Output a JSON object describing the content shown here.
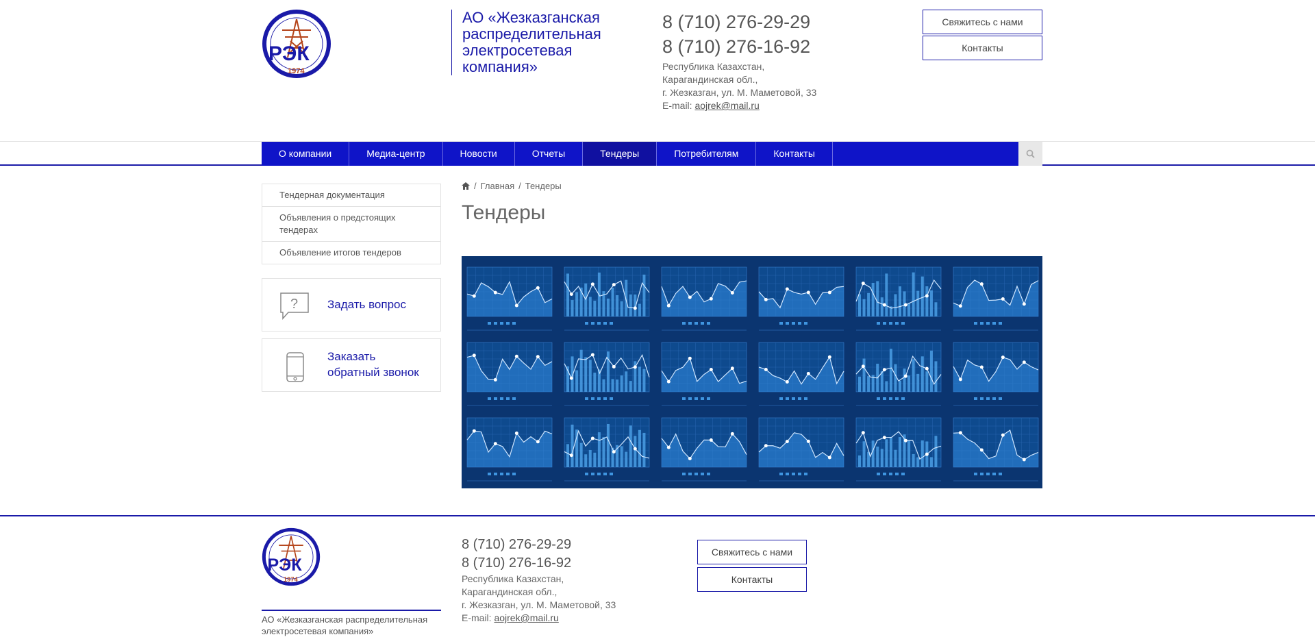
{
  "logo": {
    "year": "1974",
    "abbr": "РЭК",
    "arc_text": "АО Жезказганская"
  },
  "header": {
    "company_name": "АО «Жезказганская распределительная электросетевая компания»",
    "phone1": "8 (710) 276-29-29",
    "phone2": "8 (710) 276-16-92",
    "address": [
      "Республика Казахстан,",
      "Карагандинская обл.,",
      "г. Жезказган, ул. М. Маметовой, 33"
    ],
    "email_label": "E-mail:",
    "email": "aojrek@mail.ru",
    "btn_contact": "Свяжитесь с нами",
    "btn_contacts": "Контакты"
  },
  "nav": {
    "items": [
      "О компании",
      "Медиа-центр",
      "Новости",
      "Отчеты",
      "Тендеры",
      "Потребителям",
      "Контакты"
    ],
    "active": "Тендеры"
  },
  "sidebar": {
    "items": [
      "Тендерная документация",
      "Объявления о предстоящих тендерах",
      "Объявление итогов тендеров"
    ],
    "ask": "Задать вопрос",
    "callback_line1": "Заказать",
    "callback_line2": "обратный звонок"
  },
  "breadcrumb": {
    "home": "Главная",
    "current": "Тендеры"
  },
  "page": {
    "title": "Тендеры"
  },
  "footer": {
    "company_name": "АО «Жезказганская распределительная электросетевая компания»",
    "phone1": "8 (710) 276-29-29",
    "phone2": "8 (710) 276-16-92",
    "address": [
      "Республика Казахстан,",
      "Карагандинская обл.,",
      "г. Жезказган, ул. М. Маметовой, 33"
    ],
    "email_label": "E-mail:",
    "email": "aojrek@mail.ru",
    "btn_contact": "Свяжитесь с нами",
    "btn_contacts": "Контакты"
  },
  "colors": {
    "brand": "#1a1aa8",
    "nav_bg": "#0f14c8",
    "hero_bg": "#0b3570",
    "logo_red": "#c0392b"
  }
}
